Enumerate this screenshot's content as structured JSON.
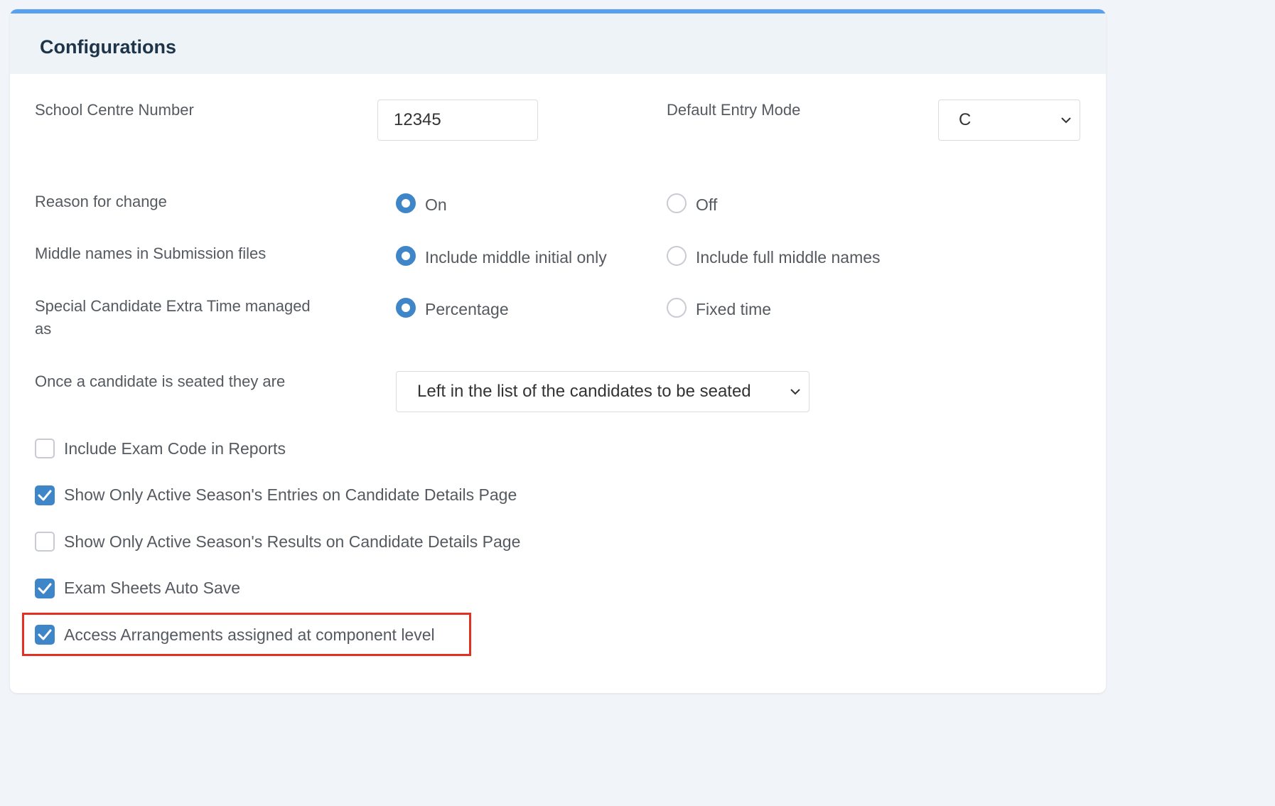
{
  "panel": {
    "title": "Configurations"
  },
  "school_centre": {
    "label": "School Centre Number",
    "value": "12345"
  },
  "default_entry_mode": {
    "label": "Default Entry Mode",
    "selected": "C"
  },
  "reason_for_change": {
    "label": "Reason for change",
    "option_on": "On",
    "option_off": "Off",
    "selected": "On"
  },
  "middle_names": {
    "label": "Middle names in Submission files",
    "option_initial": "Include middle initial only",
    "option_full": "Include full middle names",
    "selected": "Include middle initial only"
  },
  "extra_time": {
    "label_line1": "Special Candidate Extra Time managed",
    "label_line2": "as",
    "option_percentage": "Percentage",
    "option_fixed": "Fixed time",
    "selected": "Percentage"
  },
  "seated": {
    "label": "Once a candidate is seated they are",
    "selected": "Left in the list of the candidates to be seated"
  },
  "checkboxes": [
    {
      "label": "Include Exam Code in Reports",
      "checked": false
    },
    {
      "label": "Show Only Active Season's Entries on Candidate Details Page",
      "checked": true
    },
    {
      "label": "Show Only Active Season's Results on Candidate Details Page",
      "checked": false
    },
    {
      "label": "Exam Sheets Auto Save",
      "checked": true
    },
    {
      "label": "Access Arrangements assigned at component level",
      "checked": true
    }
  ],
  "colors": {
    "accent": "#3f86c9",
    "top_bar": "#5aa0f0",
    "highlight": "#e33020"
  }
}
